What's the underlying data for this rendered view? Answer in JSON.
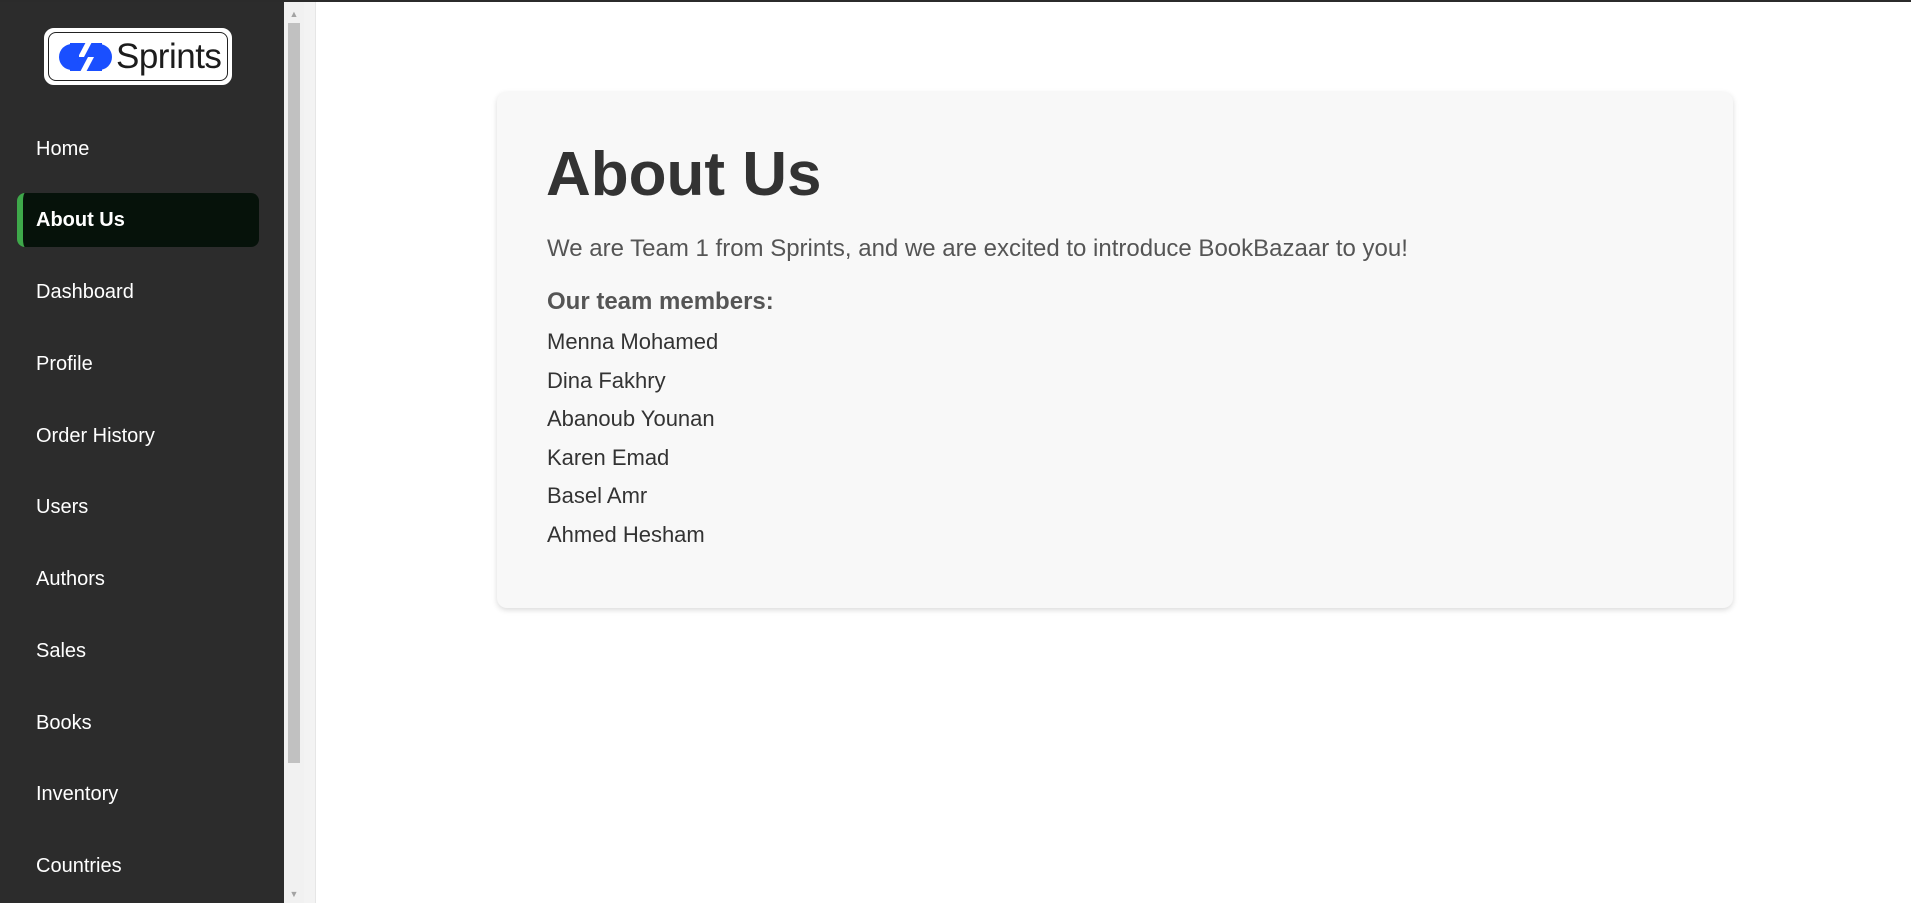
{
  "sidebar": {
    "logo_text": "Sprints",
    "items": [
      {
        "label": "Home",
        "active": false
      },
      {
        "label": "About Us",
        "active": true
      },
      {
        "label": "Dashboard",
        "active": false
      },
      {
        "label": "Profile",
        "active": false
      },
      {
        "label": "Order History",
        "active": false
      },
      {
        "label": "Users",
        "active": false
      },
      {
        "label": "Authors",
        "active": false
      },
      {
        "label": "Sales",
        "active": false
      },
      {
        "label": "Books",
        "active": false
      },
      {
        "label": "Inventory",
        "active": false
      },
      {
        "label": "Countries",
        "active": false
      }
    ]
  },
  "main": {
    "title": "About Us",
    "intro": "We are Team 1 from Sprints, and we are excited to introduce BookBazaar to you!",
    "team_heading": "Our team members:",
    "members": [
      "Menna Mohamed",
      "Dina Fakhry",
      "Abanoub Younan",
      "Karen Emad",
      "Basel Amr",
      "Ahmed Hesham"
    ]
  },
  "colors": {
    "sidebar_bg": "#2c2c2c",
    "active_bg": "#06120a",
    "active_accent": "#3ea84a",
    "logo_blue": "#1a4fff"
  }
}
